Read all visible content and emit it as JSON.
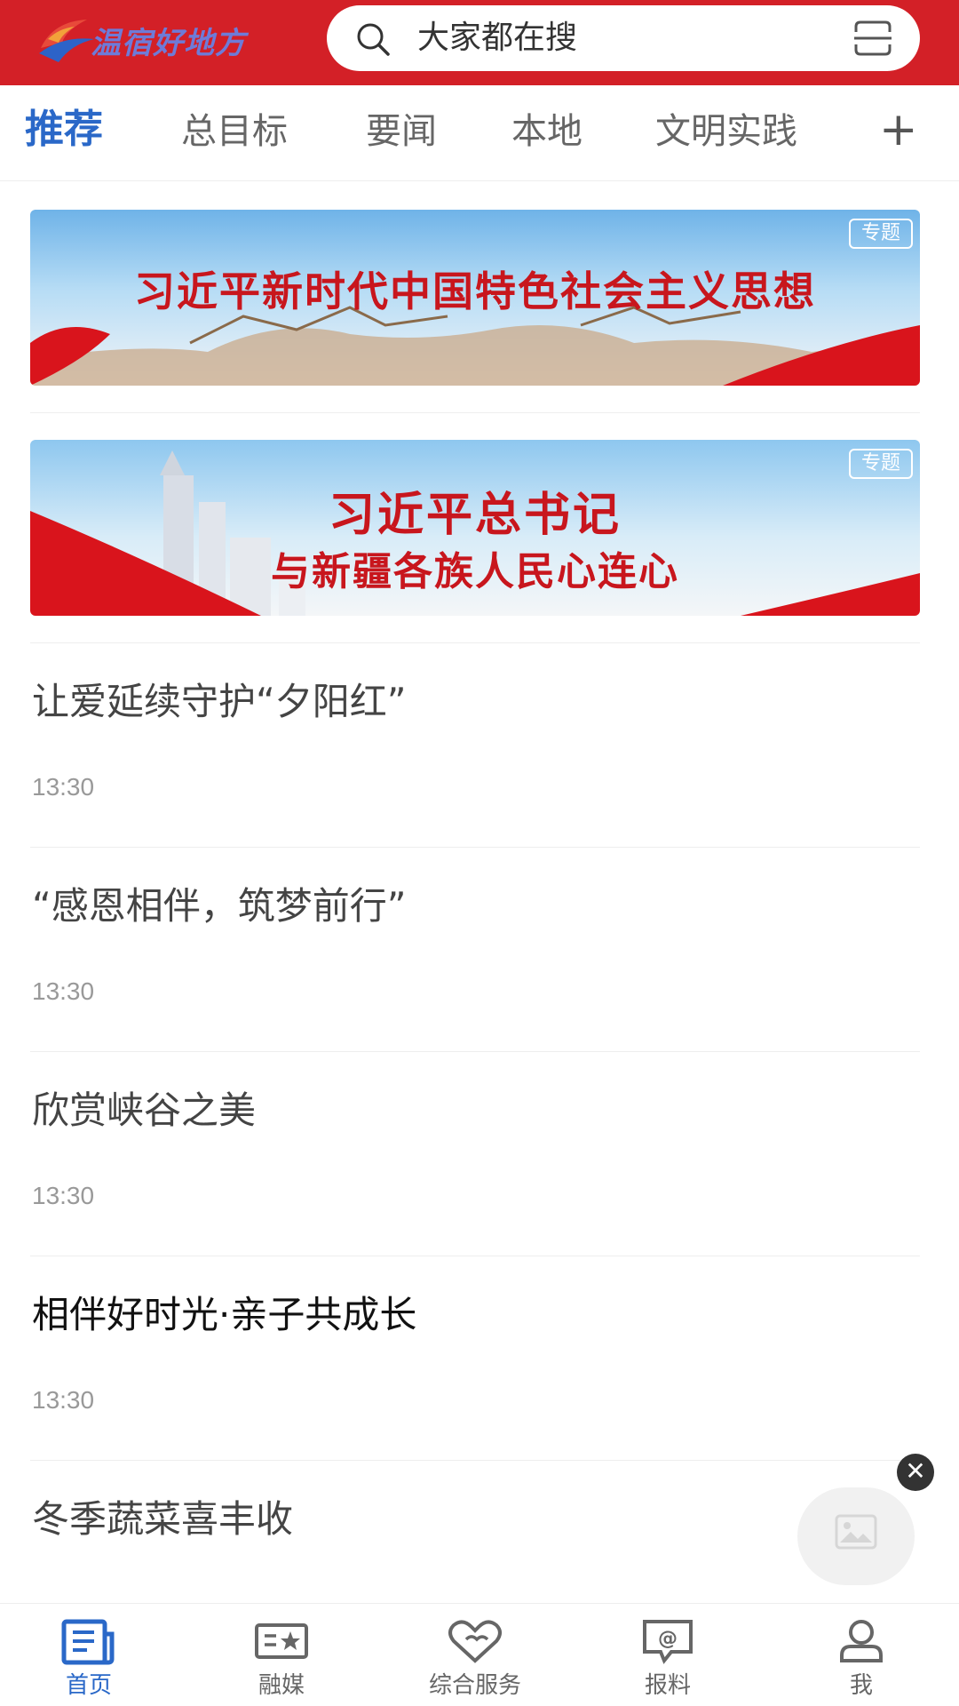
{
  "header": {
    "logo_text": "温宿好地方",
    "search_placeholder": "大家都在搜"
  },
  "tabs": [
    {
      "label": "推荐",
      "active": true
    },
    {
      "label": "总目标"
    },
    {
      "label": "要闻"
    },
    {
      "label": "本地"
    },
    {
      "label": "文明实践"
    }
  ],
  "tab_more": "+",
  "banners": [
    {
      "tag": "专题",
      "title": "习近平新时代中国特色社会主义思想"
    },
    {
      "tag": "专题",
      "title_line1": "习近平总书记",
      "title_line2": "与新疆各族人民心连心"
    }
  ],
  "news": [
    {
      "title": "让爱延续守护“夕阳红”",
      "time": "13:30"
    },
    {
      "title": "“感恩相伴，筑梦前行”",
      "time": "13:30"
    },
    {
      "title": "欣赏峡谷之美",
      "time": "13:30"
    },
    {
      "title": "相伴好时光·亲子共成长",
      "time": "13:30"
    },
    {
      "title": "冬季蔬菜喜丰收"
    }
  ],
  "float_close": "✕",
  "bottom_nav": [
    {
      "label": "首页",
      "icon": "news-icon",
      "active": true
    },
    {
      "label": "融媒",
      "icon": "media-icon"
    },
    {
      "label": "综合服务",
      "icon": "heart-icon"
    },
    {
      "label": "报料",
      "icon": "report-icon"
    },
    {
      "label": "我",
      "icon": "user-icon"
    }
  ],
  "colors": {
    "brand_red": "#d32027",
    "accent_blue": "#2a68c8"
  }
}
